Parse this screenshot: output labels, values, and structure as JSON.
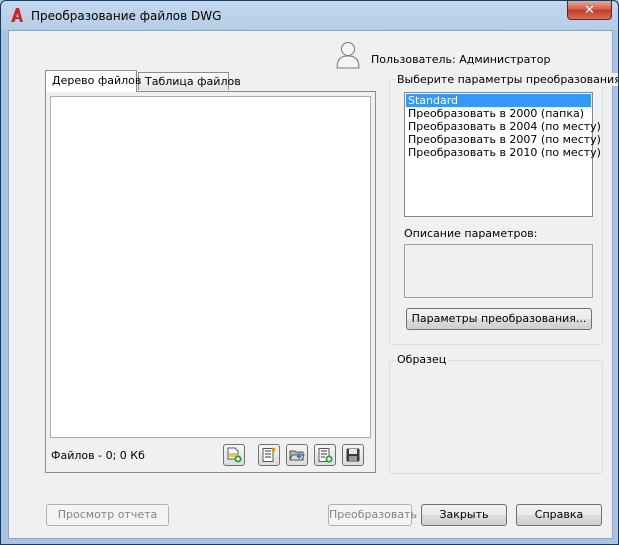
{
  "window": {
    "title": "Преобразование файлов DWG",
    "close_symbol": "✕",
    "app_icon": "autocad-a-icon"
  },
  "user": {
    "label": "Пользователь: Администратор",
    "icon": "user-icon"
  },
  "tabs": [
    {
      "label": "Дерево файлов",
      "active": true
    },
    {
      "label": "Таблица файлов",
      "active": false
    }
  ],
  "file_tree": {
    "status": "Файлов - 0; 0 Кб",
    "toolbar_icons": [
      "add-file-icon",
      "file-list-icon",
      "open-folder-icon",
      "edit-list-icon",
      "save-icon"
    ]
  },
  "setup": {
    "group_label": "Выберите параметры преобразования",
    "options": [
      {
        "label": "Standard",
        "selected": true
      },
      {
        "label": "Преобразовать в 2000 (папка)",
        "selected": false
      },
      {
        "label": "Преобразовать в 2004 (по месту)",
        "selected": false
      },
      {
        "label": "Преобразовать в 2007 (по месту)",
        "selected": false
      },
      {
        "label": "Преобразовать в 2010 (по месту)",
        "selected": false
      }
    ],
    "description_label": "Описание параметров:",
    "description_value": "",
    "setups_button": "Параметры преобразования..."
  },
  "sample": {
    "label": "Образец"
  },
  "buttons": {
    "view_report": "Просмотр отчета",
    "convert": "Преобразовать",
    "close": "Закрыть",
    "help": "Справка"
  }
}
